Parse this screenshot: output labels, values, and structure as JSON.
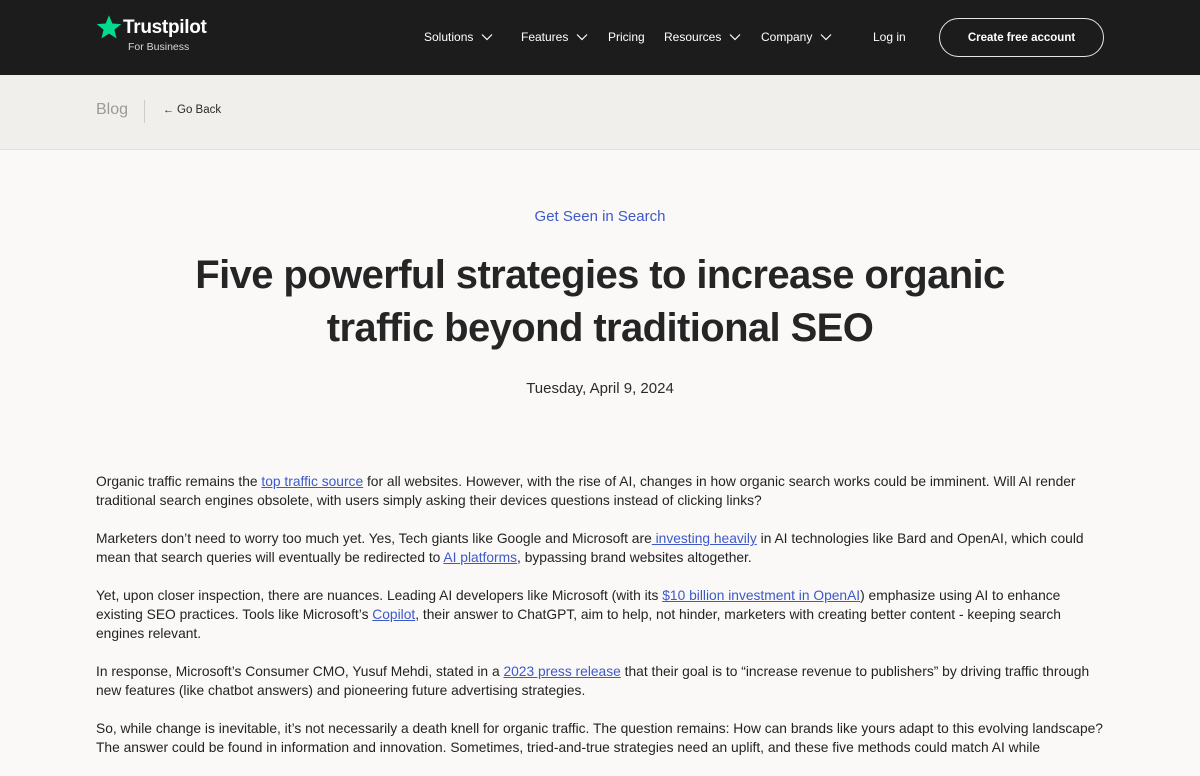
{
  "nav": {
    "logo_text": "Trustpilot",
    "logo_sub": "For Business",
    "solutions": "Solutions",
    "features": "Features",
    "pricing": "Pricing",
    "resources": "Resources",
    "company": "Company",
    "login": "Log in",
    "cta": "Create free account"
  },
  "breadcrumb": {
    "blog": "Blog",
    "go_back": "Go Back",
    "back_arrow": "←"
  },
  "hero": {
    "category": "Get Seen in Search",
    "title": "Five powerful strategies to increase organic traffic beyond traditional SEO",
    "date": "Tuesday, April 9, 2024"
  },
  "article": {
    "p1_a": "Organic traffic remains the ",
    "p1_link": "top traffic source",
    "p1_b": " for all websites. However, with the rise of AI, changes in how organic search works could be imminent. Will AI render traditional search engines obsolete, with users simply asking their devices questions instead of clicking links?",
    "p2_a": "Marketers don’t need to worry too much yet. Yes, Tech giants like Google and Microsoft are",
    "p2_link1": " investing heavily",
    "p2_b": " in AI technologies like Bard and OpenAI, which could mean that search queries will eventually be redirected to ",
    "p2_link2": "AI platforms",
    "p2_c": ", bypassing brand websites altogether.",
    "p3_a": "Yet, upon closer inspection, there are nuances. Leading AI developers like Microsoft (with its ",
    "p3_link1": "$10 billion investment in OpenAI",
    "p3_b": ") emphasize using AI to enhance existing SEO practices. Tools like Microsoft’s ",
    "p3_link2": "Copilot",
    "p3_c": ", their answer to ChatGPT, aim to help, not hinder, marketers with creating better content - keeping search engines relevant.",
    "p4_a": "In response, Microsoft’s Consumer CMO, Yusuf Mehdi, stated in a ",
    "p4_link": "2023 press release",
    "p4_b": " that their goal is to “increase revenue to publishers” by driving traffic through new features (like chatbot answers) and pioneering future advertising strategies.",
    "p5": "So, while change is inevitable, it’s not necessarily a death knell for organic traffic. The question remains: How can brands like yours adapt to this evolving landscape? The answer could be found in information and innovation. Sometimes, tried-and-true strategies need an uplift, and these five methods could match AI while"
  },
  "colors": {
    "nav_bg": "#1c1c1c",
    "brand_star": "#04da8d",
    "link": "#3d59c9",
    "subbar_bg": "#f1efec",
    "page_bg": "#faf9f7"
  },
  "icons": {
    "logo": "star-icon",
    "dropdown": "chevron-down-icon",
    "back": "arrow-left-icon"
  }
}
